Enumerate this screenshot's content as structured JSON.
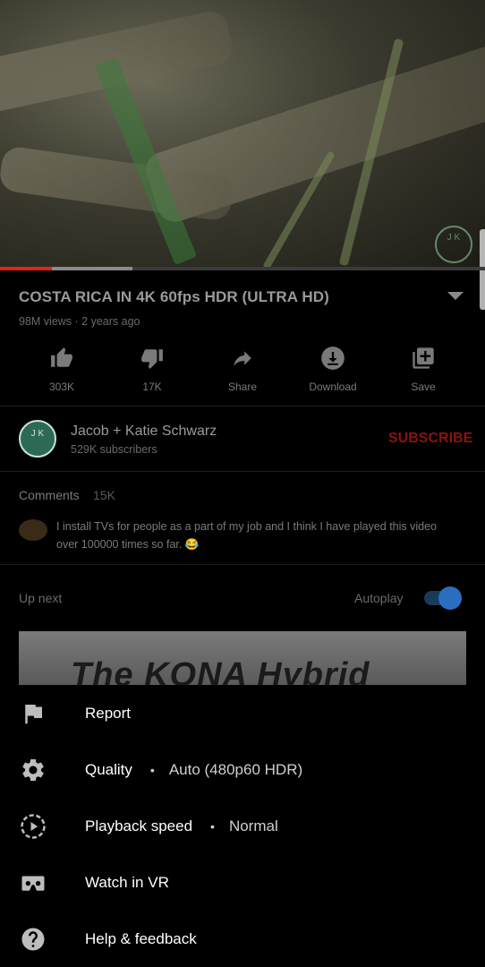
{
  "video": {
    "title": "COSTA RICA IN 4K 60fps HDR (ULTRA HD)",
    "meta": "98M views · 2 years ago",
    "progress_played": 0.107,
    "progress_buffered": 0.273,
    "watermark_text": "J K"
  },
  "actions": [
    {
      "icon": "thumbs-up-icon",
      "label": "303K"
    },
    {
      "icon": "thumbs-down-icon",
      "label": "17K"
    },
    {
      "icon": "share-icon",
      "label": "Share"
    },
    {
      "icon": "download-icon",
      "label": "Download"
    },
    {
      "icon": "save-playlist-icon",
      "label": "Save"
    }
  ],
  "channel": {
    "avatar_text": "J K",
    "name": "Jacob + Katie Schwarz",
    "subscribers": "529K subscribers",
    "subscribe_label": "SUBSCRIBE"
  },
  "comments": {
    "label": "Comments",
    "count": "15K",
    "top_comment": "I install TVs for people as a part of my job and I think I have played this video over 100000 times so far. 😂"
  },
  "upnext": {
    "label": "Up next",
    "autoplay_label": "Autoplay",
    "autoplay_on": true,
    "thumbnail_text": "The KONA Hybrid"
  },
  "menu": [
    {
      "icon": "flag-icon",
      "label": "Report",
      "value": ""
    },
    {
      "icon": "gear-icon",
      "label": "Quality",
      "value": "Auto (480p60 HDR)"
    },
    {
      "icon": "playback-speed-icon",
      "label": "Playback speed",
      "value": "Normal"
    },
    {
      "icon": "vr-headset-icon",
      "label": "Watch in VR",
      "value": ""
    },
    {
      "icon": "help-icon",
      "label": "Help & feedback",
      "value": ""
    }
  ],
  "colors": {
    "accent_red": "#e62117",
    "autoplay_blue": "#2a6ec0",
    "sheet_bg": "#000000"
  }
}
